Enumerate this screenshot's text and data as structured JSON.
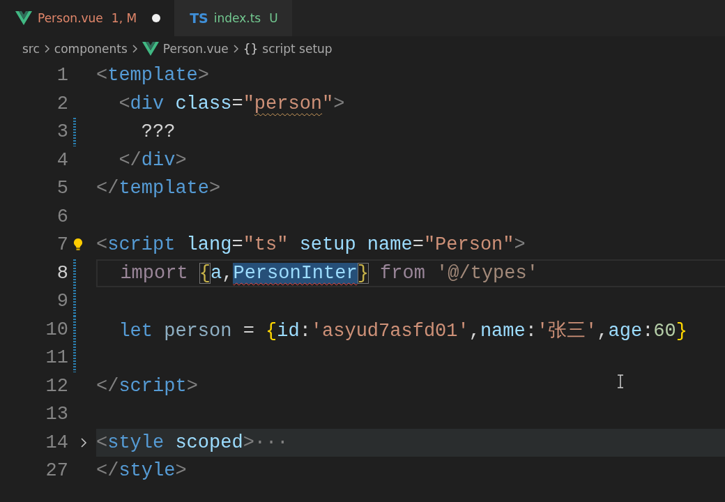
{
  "tabs": [
    {
      "kind": "vue",
      "label": "Person.vue",
      "status": "1, M",
      "color": "#e2876b",
      "selected": true,
      "dirty": true
    },
    {
      "kind": "ts",
      "icon_text": "TS",
      "label": "index.ts",
      "status": "U",
      "color": "#73c991",
      "selected": false,
      "dirty": false
    }
  ],
  "breadcrumb": [
    {
      "kind": "folder",
      "text": "src"
    },
    {
      "kind": "folder",
      "text": "components"
    },
    {
      "kind": "vue",
      "text": "Person.vue"
    },
    {
      "kind": "symbol",
      "icon_text": "{}",
      "text": "script setup"
    }
  ],
  "lines": [
    {
      "number": "1",
      "modified": false,
      "current": false,
      "folded": false,
      "lightbulb": false,
      "tokens": [
        {
          "kind": "punct",
          "text": "<"
        },
        {
          "kind": "tag",
          "text": "template"
        },
        {
          "kind": "punct",
          "text": ">"
        }
      ]
    },
    {
      "number": "2",
      "modified": false,
      "current": false,
      "folded": false,
      "lightbulb": false,
      "tokens": [
        {
          "kind": "punct",
          "text": "  <"
        },
        {
          "kind": "tag",
          "text": "div"
        },
        {
          "kind": "attr",
          "text": " class"
        },
        {
          "kind": "plain",
          "text": "="
        },
        {
          "kind": "string",
          "text": "\""
        },
        {
          "kind": "string-warning",
          "text": "person"
        },
        {
          "kind": "string",
          "text": "\""
        },
        {
          "kind": "punct",
          "text": ">"
        }
      ]
    },
    {
      "number": "3",
      "modified": true,
      "current": false,
      "folded": false,
      "lightbulb": false,
      "tokens": [
        {
          "kind": "plain",
          "text": "    ???"
        }
      ]
    },
    {
      "number": "4",
      "modified": false,
      "current": false,
      "folded": false,
      "lightbulb": false,
      "tokens": [
        {
          "kind": "punct",
          "text": "  </"
        },
        {
          "kind": "tag",
          "text": "div"
        },
        {
          "kind": "punct",
          "text": ">"
        }
      ]
    },
    {
      "number": "5",
      "modified": false,
      "current": false,
      "folded": false,
      "lightbulb": false,
      "tokens": [
        {
          "kind": "punct",
          "text": "</"
        },
        {
          "kind": "tag",
          "text": "template"
        },
        {
          "kind": "punct",
          "text": ">"
        }
      ]
    },
    {
      "number": "6",
      "modified": false,
      "current": false,
      "folded": false,
      "lightbulb": false
    },
    {
      "number": "7",
      "modified": false,
      "current": false,
      "folded": false,
      "lightbulb": true,
      "tokens": [
        {
          "kind": "punct",
          "text": "<"
        },
        {
          "kind": "tag",
          "text": "script"
        },
        {
          "kind": "attr",
          "text": " lang"
        },
        {
          "kind": "plain",
          "text": "="
        },
        {
          "kind": "string",
          "text": "\"ts\""
        },
        {
          "kind": "attr",
          "text": " setup"
        },
        {
          "kind": "attr",
          "text": " name"
        },
        {
          "kind": "plain",
          "text": "="
        },
        {
          "kind": "string",
          "text": "\"Person\""
        },
        {
          "kind": "punct",
          "text": ">"
        }
      ]
    },
    {
      "number": "8",
      "modified": true,
      "current": true,
      "folded": false,
      "lightbulb": false,
      "tokens": [
        {
          "kind": "keyword-dim",
          "text": "  import "
        },
        {
          "kind": "brace-match",
          "text": "{"
        },
        {
          "kind": "var",
          "text": "a"
        },
        {
          "kind": "plain",
          "text": ","
        },
        {
          "kind": "var-selected-error",
          "text": "PersonInter"
        },
        {
          "kind": "brace-match",
          "text": "}"
        },
        {
          "kind": "keyword-dim",
          "text": " from "
        },
        {
          "kind": "string-dim",
          "text": "'@/types'"
        }
      ]
    },
    {
      "number": "9",
      "modified": true,
      "current": false,
      "folded": false,
      "lightbulb": false
    },
    {
      "number": "10",
      "modified": true,
      "current": false,
      "folded": false,
      "lightbulb": false,
      "tokens": [
        {
          "kind": "storage",
          "text": "  let"
        },
        {
          "kind": "var-dim",
          "text": " person"
        },
        {
          "kind": "plain",
          "text": " = "
        },
        {
          "kind": "brace",
          "text": "{"
        },
        {
          "kind": "var",
          "text": "id"
        },
        {
          "kind": "plain",
          "text": ":"
        },
        {
          "kind": "string",
          "text": "'asyud7asfd01'"
        },
        {
          "kind": "plain",
          "text": ","
        },
        {
          "kind": "var",
          "text": "name"
        },
        {
          "kind": "plain",
          "text": ":"
        },
        {
          "kind": "string",
          "text": "'张三'"
        },
        {
          "kind": "plain",
          "text": ","
        },
        {
          "kind": "var",
          "text": "age"
        },
        {
          "kind": "plain",
          "text": ":"
        },
        {
          "kind": "number",
          "text": "60"
        },
        {
          "kind": "brace",
          "text": "}"
        }
      ]
    },
    {
      "number": "11",
      "modified": true,
      "current": false,
      "folded": false,
      "lightbulb": false
    },
    {
      "number": "12",
      "modified": false,
      "current": false,
      "folded": false,
      "lightbulb": false,
      "tokens": [
        {
          "kind": "punct",
          "text": "</"
        },
        {
          "kind": "tag",
          "text": "script"
        },
        {
          "kind": "punct",
          "text": ">"
        }
      ]
    },
    {
      "number": "13",
      "modified": false,
      "current": false,
      "folded": false,
      "lightbulb": false
    },
    {
      "number": "14",
      "modified": false,
      "current": false,
      "folded": true,
      "lightbulb": false,
      "tokens": [
        {
          "kind": "punct",
          "text": "<"
        },
        {
          "kind": "tag",
          "text": "style"
        },
        {
          "kind": "attr",
          "text": " scoped"
        },
        {
          "kind": "punct",
          "text": ">···"
        }
      ]
    },
    {
      "number": "27",
      "modified": false,
      "current": false,
      "folded": false,
      "lightbulb": false,
      "tokens": [
        {
          "kind": "punct",
          "text": "</"
        },
        {
          "kind": "tag",
          "text": "style"
        },
        {
          "kind": "punct",
          "text": ">"
        }
      ]
    }
  ]
}
